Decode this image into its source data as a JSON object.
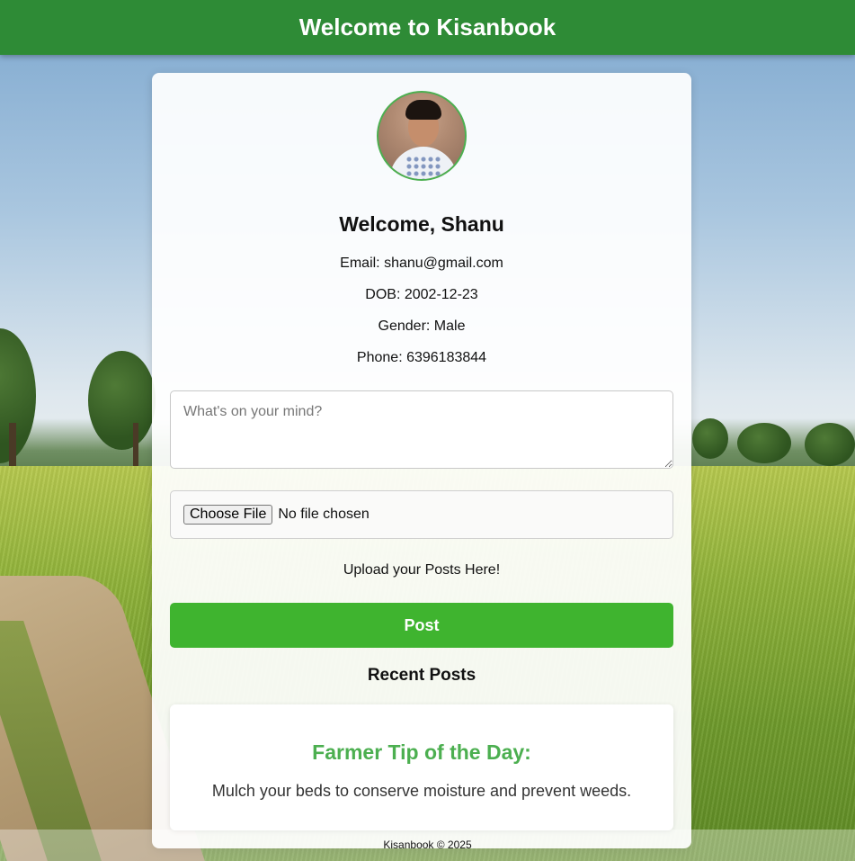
{
  "header": {
    "title": "Welcome to Kisanbook"
  },
  "profile": {
    "welcome": "Welcome, Shanu",
    "email": "Email: shanu@gmail.com",
    "dob": "DOB: 2002-12-23",
    "gender": "Gender: Male",
    "phone": "Phone: 6396183844"
  },
  "composer": {
    "placeholder": "What's on your mind?",
    "file_button": "Choose File",
    "file_status": "No file chosen",
    "upload_text": "Upload your Posts Here!",
    "post_label": "Post"
  },
  "recent": {
    "heading": "Recent Posts"
  },
  "tip": {
    "title": "Farmer Tip of the Day:",
    "text": "Mulch your beds to conserve moisture and prevent weeds."
  },
  "footer": {
    "text": "Kisanbook © 2025"
  },
  "colors": {
    "header": "#2e8b36",
    "accent": "#4caf50",
    "post_button": "#3fb42f"
  }
}
